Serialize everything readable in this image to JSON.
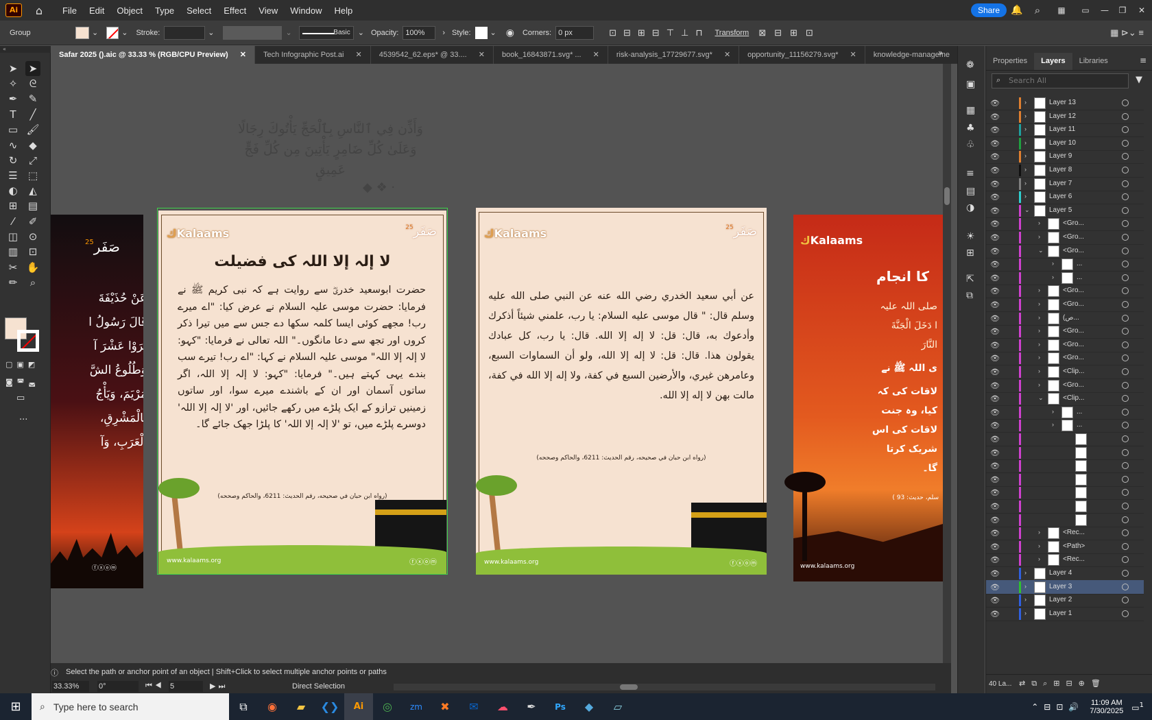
{
  "app": {
    "logo": "Ai",
    "share": "Share"
  },
  "menu": [
    "File",
    "Edit",
    "Object",
    "Type",
    "Select",
    "Effect",
    "View",
    "Window",
    "Help"
  ],
  "control": {
    "group": "Group",
    "stroke_label": "Stroke:",
    "brush": "Basic",
    "opacity_label": "Opacity:",
    "opacity": "100%",
    "style_label": "Style:",
    "corners_label": "Corners:",
    "corners": "0 px",
    "transform": "Transform"
  },
  "tabs": [
    {
      "label": "Safar 2025 ().aic @ 33.33 % (RGB/CPU Preview)"
    },
    {
      "label": "Tech Infographic Post.ai"
    },
    {
      "label": "4539542_62.eps* @ 33...."
    },
    {
      "label": "book_16843871.svg* ..."
    },
    {
      "label": "risk-analysis_17729677.svg*"
    },
    {
      "label": "opportunity_11156279.svg*"
    },
    {
      "label": "knowledge-manageme"
    }
  ],
  "canvas": {
    "header_ar": "وَأَذِّن فِي ٱلنَّاسِ بِٱلْحَجِّ يَأْتُوكَ رِجَالًا وَعَلَىٰ كُلِّ ضَامِرٍ يَأْتِينَ مِن كُلِّ فَجٍّ عَمِيقٍ",
    "left_partial": {
      "badge": "25",
      "lines": [
        "عَنْ حُذَيْفَةَ",
        "قَالَ رَسُولُ ا",
        "تَرَوْا عَشْرَ آ",
        "وَطُلُوعُ الشَّ",
        "مَرْيَمَ، وَيَأْجُ",
        "بِالْمَشْرِقِ،",
        "الْعَرَبِ، وَآ"
      ]
    },
    "board1": {
      "brand": "Kalaams",
      "badge": "25",
      "title": "لا إلہ إلا اللہ کی فضیلت",
      "body": "حضرت ابوسعید خدریؓ سے روایت ہے کہ نبی کریم ﷺ نے فرمایا: حضرت موسی علیہ السلام نے عرض کیا: \"اے میرے رب! مجھے کوئی ایسا کلمہ سکھا دے جس سے میں تیرا ذکر کروں اور تجھ سے دعا مانگوں۔\" اللہ تعالی نے فرمایا: \"کہو: لا إلہ إلا اللہ\" موسی علیہ السلام نے کہا: \"اے رب! تیرے سب بندے یہی کہتے ہیں۔\" فرمایا: \"کہو: لا إلہ إلا اللہ، اگر ساتوں آسمان اور ان کے باشندے میرے سوا، اور ساتوں زمینیں ترازو کے ایک پلڑے میں رکھے جائیں، اور 'لا إلہ إلا اللہ' دوسرے پلڑے میں، تو 'لا إلہ إلا اللہ' کا پلڑا جھک جائے گا۔",
      "ref": "(رواه ابن حبان في صحيحه، رقم الحديث: 6211، والحاكم وصححه)",
      "site": "www.kalaams.org"
    },
    "board2": {
      "brand": "Kalaams",
      "badge": "25",
      "body": "عن أبي سعيد الخدري رضي الله عنه عن النبي صلى الله عليه وسلم قال: \" قال موسى عليه السلام: يا رب، علمني شيئاً أذكرك وأدعوك به، قال: قل: لا إله إلا الله. قال: يا رب، كل عبادك يقولون هذا. قال: قل: لا إله إلا الله، ولو أن السماوات السبع، وعامرهن غيري، والأرضين السبع في كفة، ولا إله إلا الله في كفة، مالت بهن لا إله إلا الله.",
      "ref": "(رواه ابن حبان في صحيحه، رقم الحديث: 6211، والحاكم وصححه)",
      "site": "www.kalaams.org"
    },
    "board3": {
      "brand": "Kalaams",
      "title": "کا انجام",
      "lines": [
        "صلی اللہ علیہ",
        "ا دَخَلَ الْجَنَّةَ",
        "النَّارَ",
        "ی اللہ ﷺ نے",
        "لاقات کی کہ",
        "کیا، وہ جنت",
        "لاقات کی اس",
        "شریک کرتا",
        "گا۔"
      ],
      "ref": "سلم، حدیث: 93 )",
      "site": "www.kalaams.org"
    }
  },
  "panel": {
    "tabs": [
      "Properties",
      "Layers",
      "Libraries"
    ],
    "search_placeholder": "Search All",
    "footer_count": "40 La...",
    "layers": [
      {
        "name": "Layer 13",
        "color": "#e08030",
        "level": 0
      },
      {
        "name": "Layer 12",
        "color": "#e08030",
        "level": 0
      },
      {
        "name": "Layer 11",
        "color": "#20a0a0",
        "level": 0
      },
      {
        "name": "Layer 10",
        "color": "#20a040",
        "level": 0
      },
      {
        "name": "Layer 9",
        "color": "#e08030",
        "level": 0
      },
      {
        "name": "Layer 8",
        "color": "#101010",
        "level": 0
      },
      {
        "name": "Layer 7",
        "color": "#808080",
        "level": 0
      },
      {
        "name": "Layer 6",
        "color": "#30d0d0",
        "level": 0
      },
      {
        "name": "Layer 5",
        "color": "#d040d0",
        "level": 0,
        "expanded": true
      },
      {
        "name": "<Gro...",
        "color": "#d040d0",
        "level": 1
      },
      {
        "name": "<Gro...",
        "color": "#d040d0",
        "level": 1
      },
      {
        "name": "<Gro...",
        "color": "#d040d0",
        "level": 1,
        "expanded": true
      },
      {
        "name": "...",
        "color": "#d040d0",
        "level": 2
      },
      {
        "name": "...",
        "color": "#d040d0",
        "level": 2
      },
      {
        "name": "<Gro...",
        "color": "#d040d0",
        "level": 1
      },
      {
        "name": "<Gro...",
        "color": "#d040d0",
        "level": 1
      },
      {
        "name": "(ص...",
        "color": "#d040d0",
        "level": 1
      },
      {
        "name": "<Gro...",
        "color": "#d040d0",
        "level": 1
      },
      {
        "name": "<Gro...",
        "color": "#d040d0",
        "level": 1
      },
      {
        "name": "<Gro...",
        "color": "#d040d0",
        "level": 1
      },
      {
        "name": "<Clip...",
        "color": "#d040d0",
        "level": 1
      },
      {
        "name": "<Gro...",
        "color": "#d040d0",
        "level": 1
      },
      {
        "name": "<Clip...",
        "color": "#d040d0",
        "level": 1,
        "expanded": true
      },
      {
        "name": "...",
        "color": "#d040d0",
        "level": 2
      },
      {
        "name": "...",
        "color": "#d040d0",
        "level": 2
      },
      {
        "name": "",
        "color": "#d040d0",
        "level": 3
      },
      {
        "name": "",
        "color": "#d040d0",
        "level": 3
      },
      {
        "name": "",
        "color": "#d040d0",
        "level": 3
      },
      {
        "name": "",
        "color": "#d040d0",
        "level": 3
      },
      {
        "name": "",
        "color": "#d040d0",
        "level": 3
      },
      {
        "name": "",
        "color": "#d040d0",
        "level": 3
      },
      {
        "name": "",
        "color": "#d040d0",
        "level": 3
      },
      {
        "name": "<Rec...",
        "color": "#d040d0",
        "level": 1
      },
      {
        "name": "<Path>",
        "color": "#d040d0",
        "level": 1
      },
      {
        "name": "<Rec...",
        "color": "#d040d0",
        "level": 1
      },
      {
        "name": "Layer 4",
        "color": "#3060e0",
        "level": 0
      },
      {
        "name": "Layer 3",
        "color": "#30c030",
        "level": 0,
        "selected": true
      },
      {
        "name": "Layer 2",
        "color": "#3060e0",
        "level": 0
      },
      {
        "name": "Layer 1",
        "color": "#3060e0",
        "level": 0
      }
    ]
  },
  "status": {
    "hint": "Select the path or anchor point of an object  |  Shift+Click to select multiple anchor points or paths",
    "zoom": "33.33%",
    "rotate": "0°",
    "artboard": "5",
    "tool": "Direct Selection"
  },
  "taskbar": {
    "search_placeholder": "Type here to search",
    "time": "11:09 AM",
    "date": "7/30/2025",
    "notif": "1"
  }
}
